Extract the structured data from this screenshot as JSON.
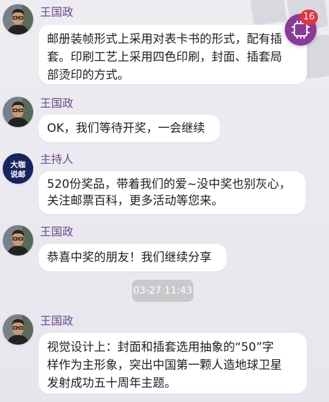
{
  "messages": [
    {
      "sender": "王国政",
      "lines": [
        "邮册装帧形式上采用对表卡书的形式，配有插",
        "套。印刷工艺上采用四色印刷，封面、插套局",
        "部烫印的方式。"
      ]
    },
    {
      "sender": "王国政",
      "lines": [
        "OK，我们等待开奖，一会继续"
      ]
    },
    {
      "sender": "主持人",
      "avatar_text": [
        "大咖",
        "说邮"
      ],
      "lines": [
        "520份奖品，带着我们的爱~没中奖也别灰心，",
        "关注邮票百科，更多活动等您来。"
      ]
    },
    {
      "sender": "王国政",
      "lines": [
        "恭喜中奖的朋友！我们继续分享"
      ]
    },
    {
      "sender": "王国政",
      "lines": [
        "视觉设计上：封面和插套选用抽象的“50”字",
        "样作为主形象，突出中国第一颗人造地球卫星",
        "发射成功五十周年主题。"
      ]
    }
  ],
  "timestamp": "03-27 11:43",
  "notification": {
    "count": "16",
    "icon": "chip-icon"
  },
  "colors": {
    "sender_name": "#6a4a8a",
    "bubble": "#ffffff",
    "background": "#ebebf0",
    "badge": "#e03540",
    "notification_button": "#8a3a9a"
  }
}
